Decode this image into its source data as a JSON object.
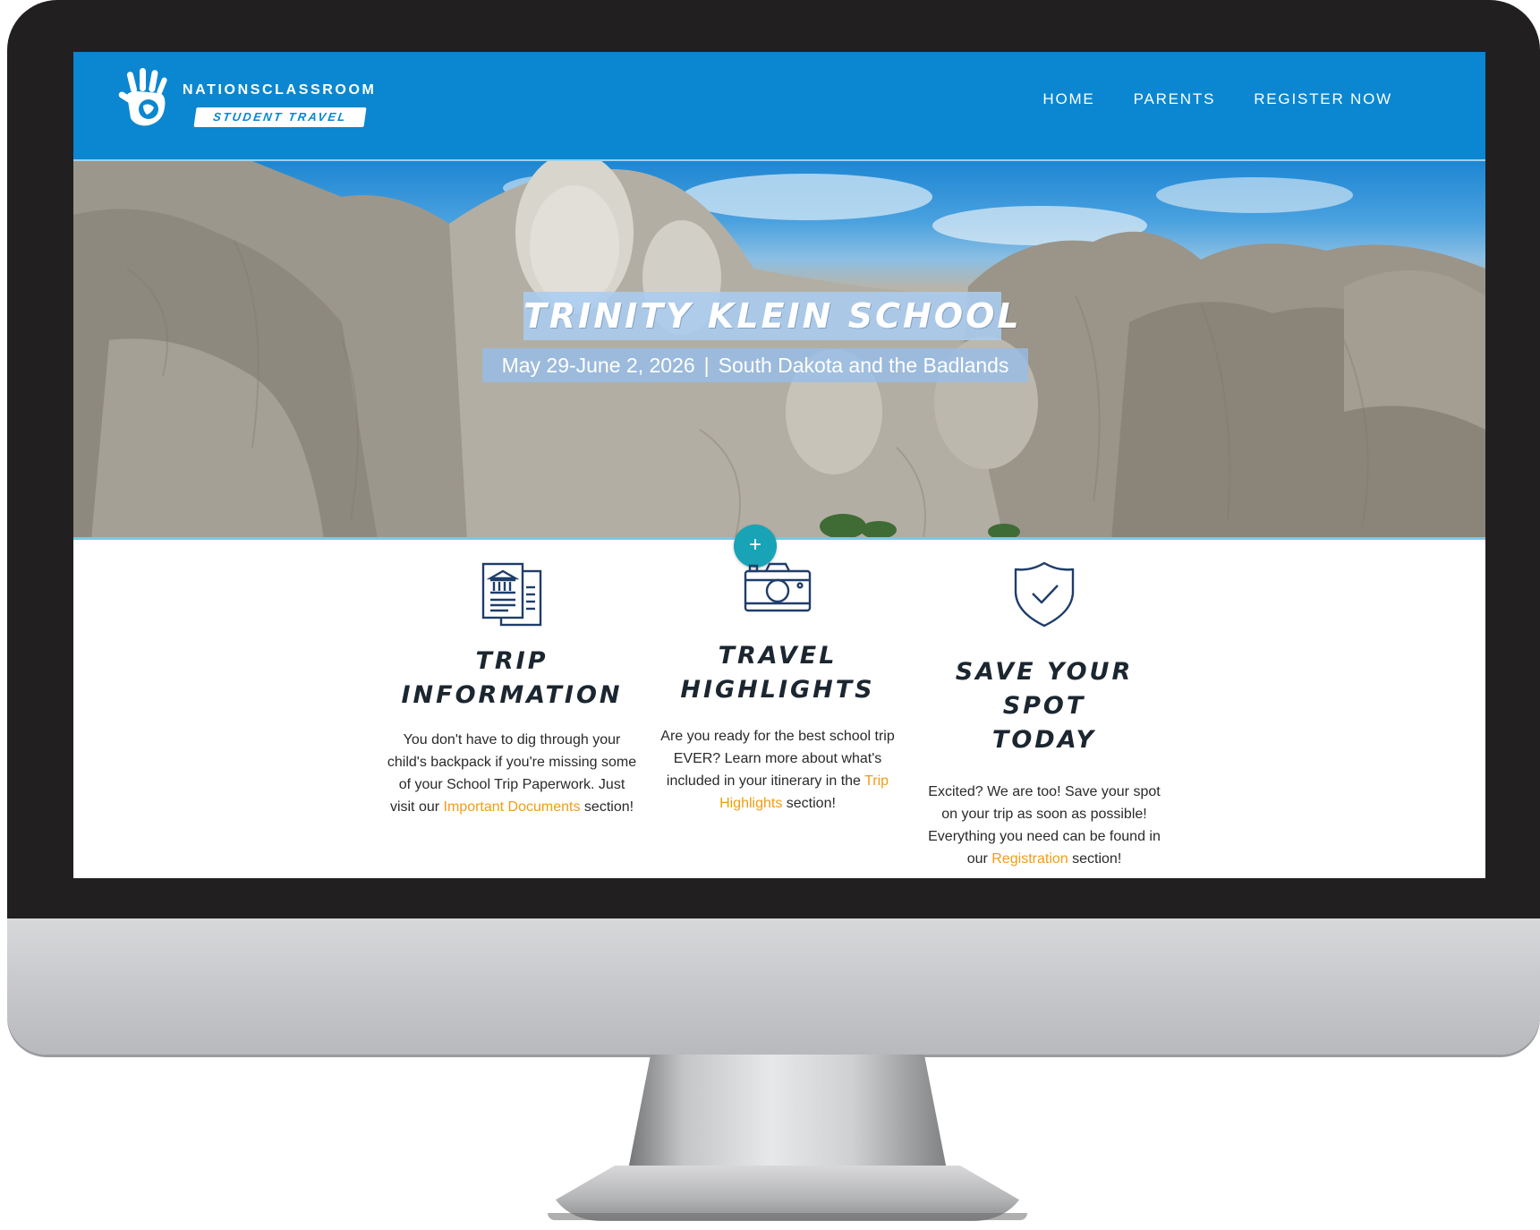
{
  "header": {
    "logo_name": "NATIONSCLASSROOM",
    "logo_tagline": "STUDENT TRAVEL",
    "nav": [
      "HOME",
      "PARENTS",
      "REGISTER NOW"
    ]
  },
  "hero": {
    "title": "TRINITY KLEIN SCHOOL",
    "dates": "May 29-June 2, 2026",
    "separator": "|",
    "destination": "South Dakota and the Badlands",
    "add_button": "+"
  },
  "features": [
    {
      "title_line1": "TRIP",
      "title_line2": "INFORMATION",
      "text_before": "You don't have to dig through your child's backpack if you're missing some of your School Trip Paperwork. Just visit our",
      "link": "Important Documents",
      "text_after": "section!"
    },
    {
      "title_line1": "TRAVEL",
      "title_line2": "HIGHLIGHTS",
      "text_before": "Are you ready for the best school trip EVER? Learn more about what's included in your itinerary in the",
      "link": "Trip Highlights",
      "text_after": "section!"
    },
    {
      "title_line1": "SAVE YOUR SPOT",
      "title_line2": "TODAY",
      "text_before": "Excited? We are too! Save your spot on your trip as soon as possible! Everything you need can be found in our",
      "link": "Registration",
      "text_after": "section!"
    }
  ],
  "colors": {
    "header_blue": "#0a87d0",
    "accent_orange": "#f39c12",
    "button_teal": "#18a3b6",
    "icon_navy": "#1f3d6b",
    "bezel": "#221f20"
  },
  "icons": [
    "hand-logo-icon",
    "documents-icon",
    "camera-icon",
    "shield-check-icon",
    "plus-icon"
  ]
}
